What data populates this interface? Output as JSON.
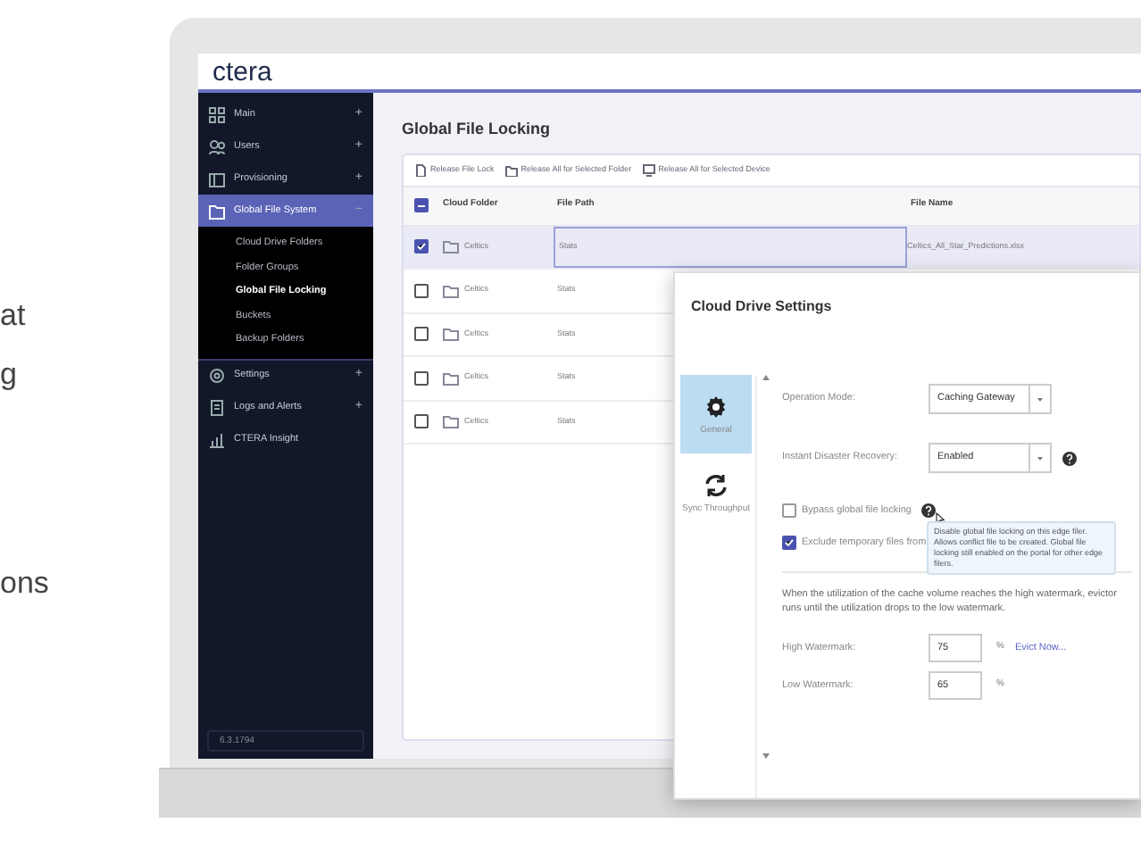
{
  "marketing_text_fragments": [
    "at",
    "g",
    "ons"
  ],
  "logo": "ctera",
  "sidebar": {
    "items": [
      {
        "label": "Main",
        "toggle": "+",
        "selected": false
      },
      {
        "label": "Users",
        "toggle": "+",
        "selected": false
      },
      {
        "label": "Provisioning",
        "toggle": "+",
        "selected": false
      },
      {
        "label": "Global File System",
        "toggle": "−",
        "selected": true,
        "expanded": true,
        "children": [
          {
            "label": "Cloud Drive Folders",
            "selected": false
          },
          {
            "label": "Folder Groups",
            "selected": false
          },
          {
            "label": "Global File Locking",
            "selected": true
          },
          {
            "label": "Buckets",
            "selected": false
          },
          {
            "label": "Backup Folders",
            "selected": false
          }
        ]
      },
      {
        "label": "Settings",
        "toggle": "+",
        "selected": false
      },
      {
        "label": "Logs and Alerts",
        "toggle": "+",
        "selected": false
      },
      {
        "label": "CTERA Insight",
        "selected": false
      }
    ],
    "version": "6.3.1794"
  },
  "page_title": "Global File Locking",
  "toolbar": [
    "Release File Lock",
    "Release All for Selected Folder",
    "Release All for Selected Device"
  ],
  "table": {
    "select_all_indeterminate": true,
    "columns": [
      "Cloud Folder",
      "File Path",
      "File Name"
    ],
    "rows": [
      {
        "cloud_folder": "Celtics",
        "file_path": "Stats",
        "file_name": "Celtics_All_Star_Predictions.xlsx",
        "selected": true
      },
      {
        "cloud_folder": "Celtics",
        "file_path": "Stats",
        "selected": false
      },
      {
        "cloud_folder": "Celtics",
        "file_path": "Stats",
        "selected": false
      },
      {
        "cloud_folder": "Celtics",
        "file_path": "Stats",
        "selected": false
      },
      {
        "cloud_folder": "Celtics",
        "file_path": "Stats",
        "selected": false
      }
    ]
  },
  "dialog": {
    "title": "Cloud Drive Settings",
    "tabs": [
      {
        "label": "General",
        "selected": true
      },
      {
        "label": "Sync Throughput",
        "selected": false
      }
    ],
    "fields": [
      {
        "kind": "select",
        "label": "Operation Mode:",
        "value": "Caching Gateway"
      },
      {
        "kind": "select",
        "label": "Instant Disaster Recovery:",
        "value": "Enabled",
        "help": true
      },
      {
        "kind": "checkbox",
        "label": "Bypass global file locking",
        "checked": false,
        "help": true
      },
      {
        "kind": "checkbox",
        "label": "Exclude temporary files from",
        "checked": true
      },
      {
        "kind": "text",
        "text": "When the utilization of the cache volume reaches the high watermark, evictor runs until the utilization drops to the low watermark."
      },
      {
        "kind": "input",
        "label": "High Watermark:",
        "value": "75",
        "suffix": "%",
        "link": "Evict Now..."
      },
      {
        "kind": "input",
        "label": "Low Watermark:",
        "value": "65",
        "suffix": "%"
      }
    ],
    "tooltip": "Disable global file locking on this edge filer. Allows conflict file to be created. Global file locking still enabled on the portal for other edge filers."
  }
}
